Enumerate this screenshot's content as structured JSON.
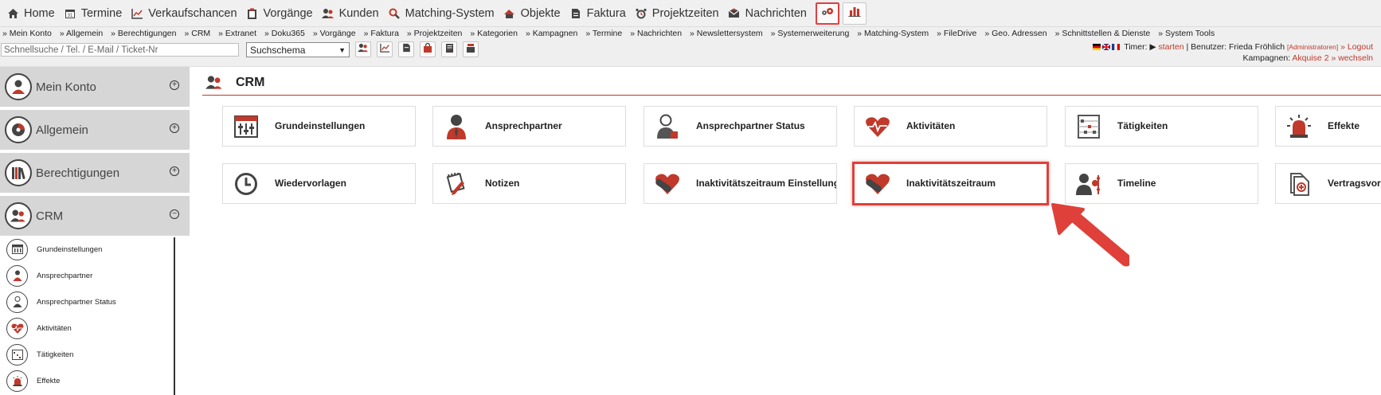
{
  "topnav": {
    "items": [
      {
        "label": "Home"
      },
      {
        "label": "Termine"
      },
      {
        "label": "Verkaufschancen"
      },
      {
        "label": "Vorgänge"
      },
      {
        "label": "Kunden"
      },
      {
        "label": "Matching-System"
      },
      {
        "label": "Objekte"
      },
      {
        "label": "Faktura"
      },
      {
        "label": "Projektzeiten"
      },
      {
        "label": "Nachrichten"
      }
    ]
  },
  "crumbs": [
    "» Mein Konto",
    "» Allgemein",
    "» Berechtigungen",
    "» CRM",
    "» Extranet",
    "» Doku365",
    "» Vorgänge",
    "» Faktura",
    "» Projektzeiten",
    "» Kategorien",
    "» Kampagnen",
    "» Termine",
    "» Nachrichten",
    "» Newslettersystem",
    "» Systemerweiterung",
    "» Matching-System",
    "» FileDrive",
    "» Geo. Adressen",
    "» Schnittstellen & Dienste",
    "» System Tools"
  ],
  "search": {
    "placeholder": "Schnellsuche / Tel. / E-Mail / Ticket-Nr",
    "schema_label": "Suchschema"
  },
  "user": {
    "timer_label": "Timer:",
    "timer_action": "starten",
    "user_label": "| Benutzer: Frieda Fröhlich",
    "role": "[Administratoren]",
    "logout": "» Logout",
    "campaign_label": "Kampagnen:",
    "campaign_value": "Akquise 2",
    "campaign_switch": "» wechseln"
  },
  "sidebar": {
    "sections": [
      {
        "label": "Mein Konto",
        "toggle": "+"
      },
      {
        "label": "Allgemein",
        "toggle": "+"
      },
      {
        "label": "Berechtigungen",
        "toggle": "+"
      },
      {
        "label": "CRM",
        "toggle": "−"
      }
    ],
    "sub_items": [
      {
        "label": "Grundeinstellungen"
      },
      {
        "label": "Ansprechpartner"
      },
      {
        "label": "Ansprechpartner Status"
      },
      {
        "label": "Aktivitäten"
      },
      {
        "label": "Tätigkeiten"
      },
      {
        "label": "Effekte"
      }
    ]
  },
  "main": {
    "title": "CRM",
    "tiles_row1": [
      {
        "label": "Grundeinstellungen"
      },
      {
        "label": "Ansprechpartner"
      },
      {
        "label": "Ansprechpartner Status"
      },
      {
        "label": "Aktivitäten"
      },
      {
        "label": "Tätigkeiten"
      },
      {
        "label": "Effekte"
      }
    ],
    "tiles_row2": [
      {
        "label": "Wiedervorlagen"
      },
      {
        "label": "Notizen"
      },
      {
        "label": "Inaktivitätszeitraum Einstellungen"
      },
      {
        "label": "Inaktivitätszeitraum"
      },
      {
        "label": "Timeline"
      },
      {
        "label": "Vertragsvorlagen"
      }
    ]
  },
  "colors": {
    "accent": "#c0392b",
    "highlight": "#e0403a",
    "icon_dark": "#555555"
  }
}
